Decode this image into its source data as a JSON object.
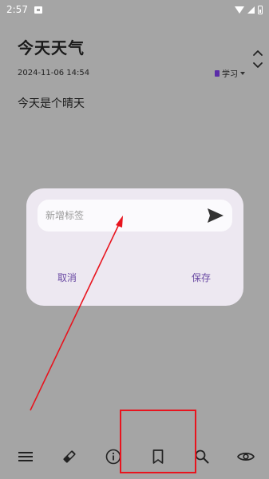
{
  "status_bar": {
    "time": "2:57"
  },
  "note": {
    "title": "今天天气",
    "datetime": "2024-11-06 14:54",
    "category": "学习",
    "body": "今天是个晴天"
  },
  "dialog": {
    "input_placeholder": "新增标签",
    "cancel_label": "取消",
    "save_label": "保存"
  },
  "colors": {
    "background": "#a5a5a5",
    "dialog_bg": "#ede8f1",
    "accent": "#6a4aa3",
    "annotation": "#e8141e",
    "category_icon": "#5b2da8"
  },
  "toolbar": {
    "icons": [
      "menu-icon",
      "eraser-icon",
      "info-icon",
      "bookmark-icon",
      "search-icon",
      "eye-icon"
    ]
  }
}
